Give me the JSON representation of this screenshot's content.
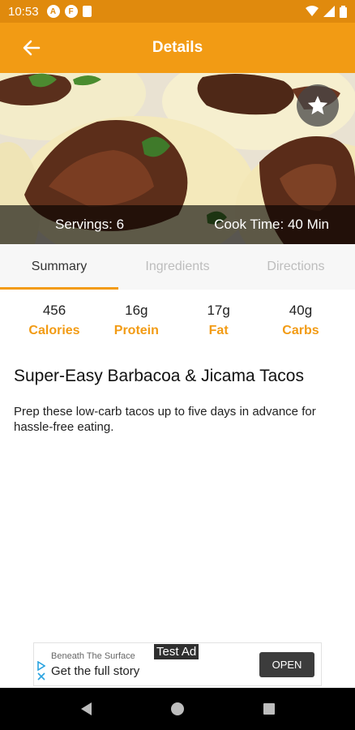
{
  "status_bar": {
    "time": "10:53",
    "left_icons": [
      "a-circle-icon",
      "f-circle-icon",
      "sd-card-icon"
    ],
    "left_icon_letters": [
      "A",
      "F"
    ],
    "right_icons": [
      "wifi-icon",
      "signal-icon",
      "battery-icon"
    ]
  },
  "app_bar": {
    "title": "Details",
    "back_icon": "arrow-left-icon"
  },
  "hero": {
    "servings": "Servings: 6",
    "cook_time": "Cook Time: 40 Min",
    "favorite_icon": "star-icon"
  },
  "tabs": [
    {
      "label": "Summary",
      "active": true
    },
    {
      "label": "Ingredients",
      "active": false
    },
    {
      "label": "Directions",
      "active": false
    }
  ],
  "nutrition": [
    {
      "value": "456",
      "label": "Calories"
    },
    {
      "value": "16g",
      "label": "Protein"
    },
    {
      "value": "17g",
      "label": "Fat"
    },
    {
      "value": "40g",
      "label": "Carbs"
    }
  ],
  "recipe": {
    "title": "Super-Easy Barbacoa & Jicama Tacos",
    "description": "Prep these low-carb tacos up to five days in advance for hassle-free eating."
  },
  "ad": {
    "advertiser": "Beneath The Surface",
    "headline": "Get the full story",
    "badge": "Test Ad",
    "cta": "OPEN"
  },
  "colors": {
    "accent": "#f29b14",
    "status_bar": "#e08a0d",
    "text": "#212121"
  },
  "nav_icons": [
    "back-triangle-icon",
    "home-circle-icon",
    "recents-square-icon"
  ]
}
